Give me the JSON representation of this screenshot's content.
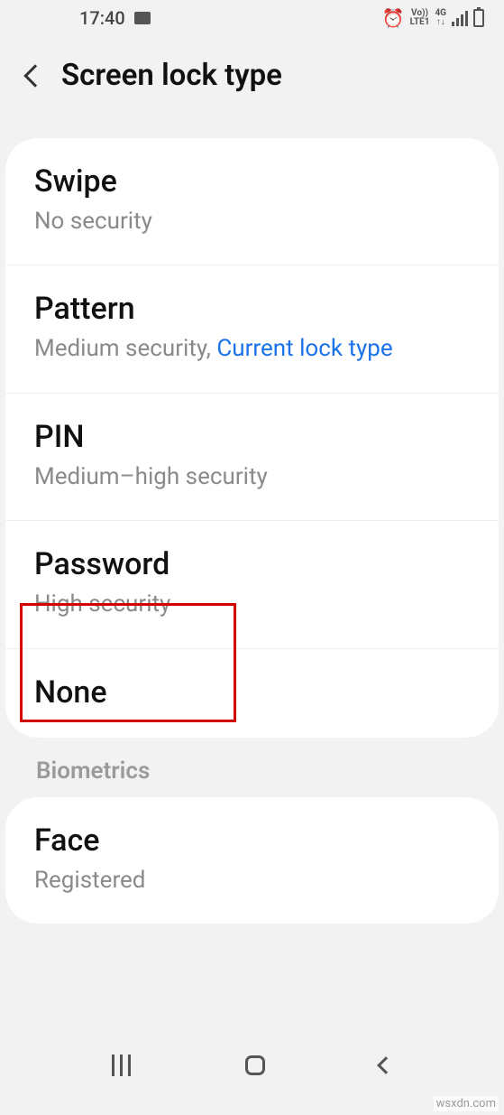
{
  "statusbar": {
    "time": "17:40",
    "indicators": {
      "volte": "Vo))",
      "lte": "LTE1",
      "net": "4G"
    }
  },
  "header": {
    "title": "Screen lock type"
  },
  "lock_types": [
    {
      "title": "Swipe",
      "desc": "No security",
      "link": ""
    },
    {
      "title": "Pattern",
      "desc": "Medium security, ",
      "link": "Current lock type"
    },
    {
      "title": "PIN",
      "desc": "Medium–high security",
      "link": ""
    },
    {
      "title": "Password",
      "desc": "High security",
      "link": ""
    },
    {
      "title": "None",
      "desc": "",
      "link": ""
    }
  ],
  "section_label": "Biometrics",
  "biometrics": [
    {
      "title": "Face",
      "desc": "Registered"
    }
  ],
  "watermark": "wsxdn.com"
}
